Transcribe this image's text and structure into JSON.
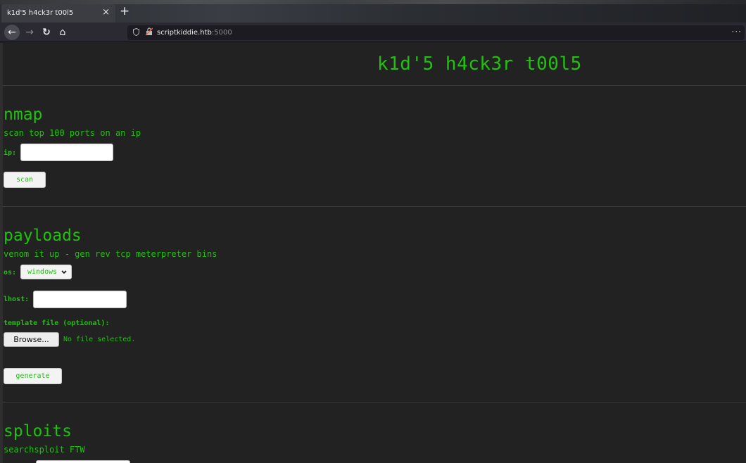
{
  "browser": {
    "tab_title": "k1d'5 h4ck3r t00l5",
    "tab_close": "×",
    "new_tab": "+",
    "back": "←",
    "forward": "→",
    "reload": "↻",
    "home": "⌂",
    "url_host": "scriptkiddie.htb",
    "url_port": ":5000",
    "menu": "···"
  },
  "page": {
    "title": "k1d'5 h4ck3r t00l5"
  },
  "nmap": {
    "heading": "nmap",
    "description": "scan top 100 ports on an ip",
    "ip_label": "ip:",
    "ip_value": "",
    "scan_button": "scan"
  },
  "payloads": {
    "heading": "payloads",
    "description": "venom it up - gen rev tcp meterpreter bins",
    "os_label": "os:",
    "os_selected": "windows",
    "lhost_label": "lhost:",
    "lhost_value": "",
    "template_label": "template file (optional):",
    "browse_button": "Browse...",
    "no_file": "No file selected.",
    "generate_button": "generate"
  },
  "sploits": {
    "heading": "sploits",
    "description": "searchsploit FTW"
  },
  "colors": {
    "accent": "#20c20e",
    "background": "#222222"
  }
}
